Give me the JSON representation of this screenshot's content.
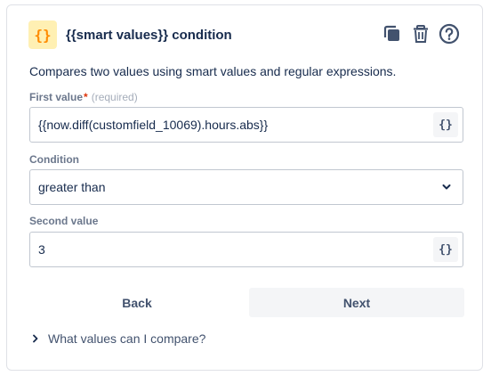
{
  "header": {
    "icon": "smart-values-braces-icon",
    "icon_glyph": "{}",
    "title": "{{smart values}} condition",
    "actions": [
      "copy-icon",
      "trash-icon",
      "help-icon"
    ]
  },
  "description": "Compares two values using smart values and regular expressions.",
  "first_value": {
    "label": "First value",
    "required_marker": "*",
    "required_hint": "(required)",
    "value": "{{now.diff(customfield_10069).hours.abs}}",
    "smart_button": "{}"
  },
  "condition": {
    "label": "Condition",
    "selected": "greater than"
  },
  "second_value": {
    "label": "Second value",
    "value": "3",
    "smart_button": "{}"
  },
  "buttons": {
    "back": "Back",
    "next": "Next"
  },
  "help": {
    "label": "What values can I compare?"
  },
  "colors": {
    "accent_bg": "#fff0b3",
    "accent_fg": "#ff8b00",
    "text": "#172b4d",
    "muted": "#6b778c"
  }
}
